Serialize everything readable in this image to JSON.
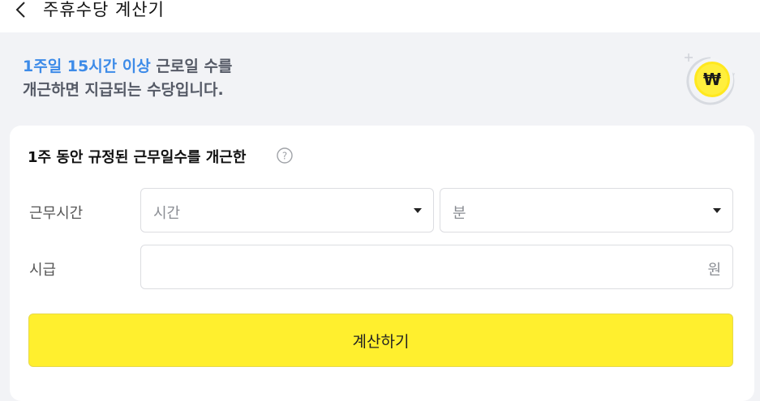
{
  "header": {
    "back_icon": "chevron-left-icon",
    "title": "주휴수당 계산기"
  },
  "intro": {
    "highlight": "1주일 15시간 이상",
    "line1_rest": " 근로일 수를",
    "line2": "개근하면 지급되는 수당입니다.",
    "highlight_color": "#3d8be8"
  },
  "coin": {
    "icon": "won-coin-icon",
    "symbol": "₩",
    "color": "#ffe81f"
  },
  "form": {
    "title": "1주 동안 규정된 근무일수를 개근한",
    "help_icon": "question-circle-icon",
    "help_symbol": "?",
    "work_time_label": "근무시간",
    "hours_placeholder": "시간",
    "minutes_placeholder": "분",
    "wage_label": "시급",
    "wage_value": "",
    "wage_unit": "원",
    "calculate_button": "계산하기",
    "button_color": "#ffef2e"
  }
}
